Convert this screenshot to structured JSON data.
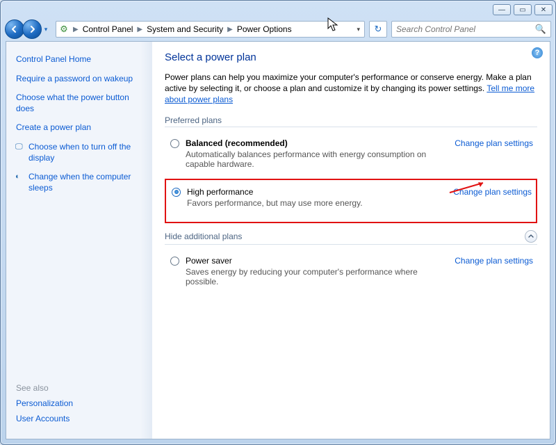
{
  "breadcrumb": {
    "items": [
      "Control Panel",
      "System and Security",
      "Power Options"
    ]
  },
  "search": {
    "placeholder": "Search Control Panel"
  },
  "sidebar": {
    "home": "Control Panel Home",
    "links": [
      "Require a password on wakeup",
      "Choose what the power button does",
      "Create a power plan",
      "Choose when to turn off the display",
      "Change when the computer sleeps"
    ],
    "see_also_label": "See also",
    "see_also": [
      "Personalization",
      "User Accounts"
    ]
  },
  "main": {
    "heading": "Select a power plan",
    "description": "Power plans can help you maximize your computer's performance or conserve energy. Make a plan active by selecting it, or choose a plan and customize it by changing its power settings. ",
    "learn_more": "Tell me more about power plans",
    "preferred_label": "Preferred plans",
    "hide_label": "Hide additional plans",
    "change_link": "Change plan settings",
    "plans": {
      "balanced": {
        "title": "Balanced (recommended)",
        "desc": "Automatically balances performance with energy consumption on capable hardware."
      },
      "high": {
        "title": "High performance",
        "desc": "Favors performance, but may use more energy."
      },
      "saver": {
        "title": "Power saver",
        "desc": "Saves energy by reducing your computer's performance where possible."
      }
    }
  }
}
